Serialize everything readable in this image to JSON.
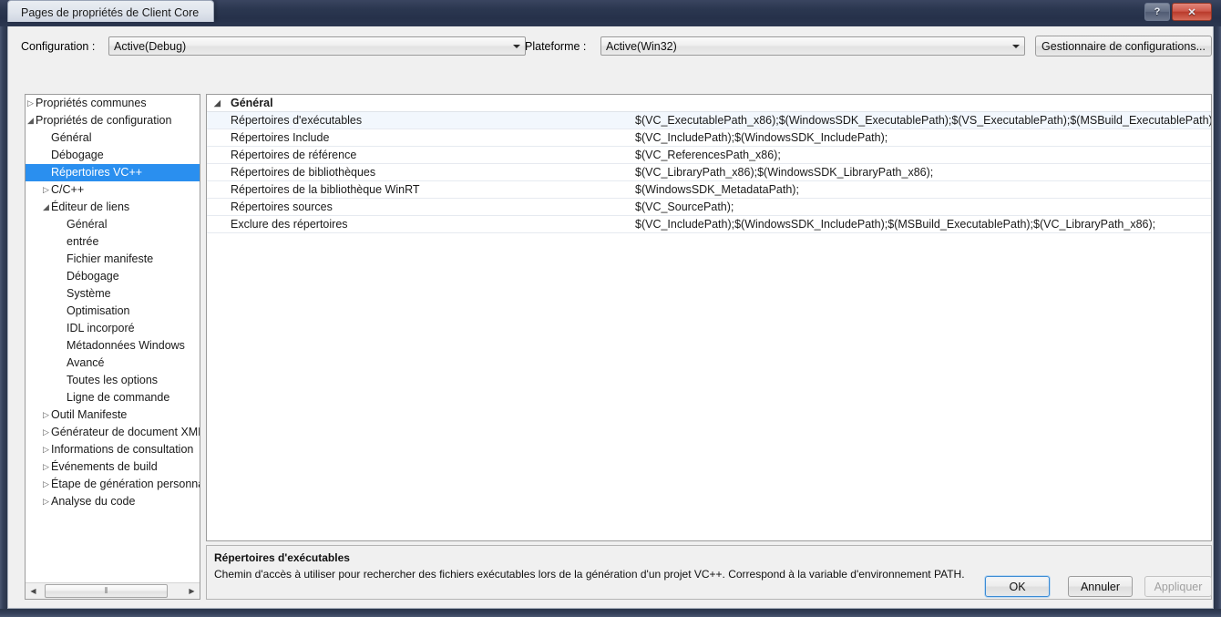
{
  "window": {
    "title": "Pages de propriétés de Client Core",
    "help_button": "?",
    "close_button": "✕"
  },
  "config_bar": {
    "configuration_label": "Configuration :",
    "configuration_value": "Active(Debug)",
    "plateforme_label": "Plateforme :",
    "plateforme_value": "Active(Win32)",
    "config_manager_button": "Gestionnaire de configurations..."
  },
  "tree": {
    "items": [
      {
        "label": "Propriétés communes",
        "indent": 0,
        "state": "collapsed",
        "selected": false
      },
      {
        "label": "Propriétés de configuration",
        "indent": 0,
        "state": "expanded",
        "selected": false
      },
      {
        "label": "Général",
        "indent": 1,
        "state": "leaf",
        "selected": false
      },
      {
        "label": "Débogage",
        "indent": 1,
        "state": "leaf",
        "selected": false
      },
      {
        "label": "Répertoires VC++",
        "indent": 1,
        "state": "leaf",
        "selected": true
      },
      {
        "label": "C/C++",
        "indent": 1,
        "state": "collapsed",
        "selected": false
      },
      {
        "label": "Éditeur de liens",
        "indent": 1,
        "state": "expanded",
        "selected": false
      },
      {
        "label": "Général",
        "indent": 2,
        "state": "leaf",
        "selected": false
      },
      {
        "label": "entrée",
        "indent": 2,
        "state": "leaf",
        "selected": false
      },
      {
        "label": "Fichier manifeste",
        "indent": 2,
        "state": "leaf",
        "selected": false
      },
      {
        "label": "Débogage",
        "indent": 2,
        "state": "leaf",
        "selected": false
      },
      {
        "label": "Système",
        "indent": 2,
        "state": "leaf",
        "selected": false
      },
      {
        "label": "Optimisation",
        "indent": 2,
        "state": "leaf",
        "selected": false
      },
      {
        "label": "IDL incorporé",
        "indent": 2,
        "state": "leaf",
        "selected": false
      },
      {
        "label": "Métadonnées Windows",
        "indent": 2,
        "state": "leaf",
        "selected": false
      },
      {
        "label": "Avancé",
        "indent": 2,
        "state": "leaf",
        "selected": false
      },
      {
        "label": "Toutes les options",
        "indent": 2,
        "state": "leaf",
        "selected": false
      },
      {
        "label": "Ligne de commande",
        "indent": 2,
        "state": "leaf",
        "selected": false
      },
      {
        "label": "Outil Manifeste",
        "indent": 1,
        "state": "collapsed",
        "selected": false
      },
      {
        "label": "Générateur de document XML",
        "indent": 1,
        "state": "collapsed",
        "selected": false
      },
      {
        "label": "Informations de consultation",
        "indent": 1,
        "state": "collapsed",
        "selected": false
      },
      {
        "label": "Événements de build",
        "indent": 1,
        "state": "collapsed",
        "selected": false
      },
      {
        "label": "Étape de génération personnalisée",
        "indent": 1,
        "state": "collapsed",
        "selected": false
      },
      {
        "label": "Analyse du code",
        "indent": 1,
        "state": "collapsed",
        "selected": false
      }
    ],
    "scrollbar": {
      "left_arrow": "◀",
      "right_arrow": "▶",
      "grip": "⦀"
    }
  },
  "grid": {
    "group_label": "Général",
    "rows": [
      {
        "name": "Répertoires d'exécutables",
        "value": "$(VC_ExecutablePath_x86);$(WindowsSDK_ExecutablePath);$(VS_ExecutablePath);$(MSBuild_ExecutablePath);$(SystemRoot)",
        "selected": true
      },
      {
        "name": "Répertoires Include",
        "value": "$(VC_IncludePath);$(WindowsSDK_IncludePath);",
        "selected": false
      },
      {
        "name": "Répertoires de référence",
        "value": "$(VC_ReferencesPath_x86);",
        "selected": false
      },
      {
        "name": "Répertoires de bibliothèques",
        "value": "$(VC_LibraryPath_x86);$(WindowsSDK_LibraryPath_x86);",
        "selected": false
      },
      {
        "name": "Répertoires de la bibliothèque WinRT",
        "value": "$(WindowsSDK_MetadataPath);",
        "selected": false
      },
      {
        "name": "Répertoires sources",
        "value": "$(VC_SourcePath);",
        "selected": false
      },
      {
        "name": "Exclure des répertoires",
        "value": "$(VC_IncludePath);$(WindowsSDK_IncludePath);$(MSBuild_ExecutablePath);$(VC_LibraryPath_x86);",
        "selected": false
      }
    ]
  },
  "description": {
    "title": "Répertoires d'exécutables",
    "text": "Chemin d'accès à utiliser pour rechercher des fichiers exécutables lors de la génération d'un projet VC++.  Correspond à la variable d'environnement PATH."
  },
  "footer": {
    "ok": "OK",
    "cancel": "Annuler",
    "apply": "Appliquer"
  },
  "colors": {
    "selection_blue": "#2a8fef",
    "frame_navy": "#2b3750",
    "close_red": "#cf5a4c",
    "dialog_bg": "#f0f0f0"
  }
}
